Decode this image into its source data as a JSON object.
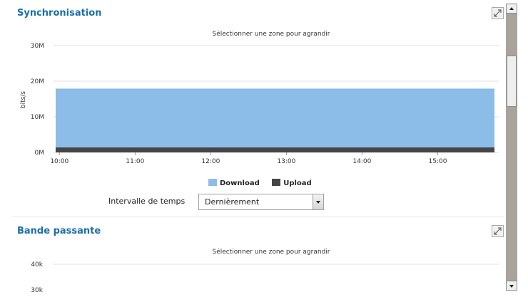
{
  "sections": [
    {
      "title": "Synchronisation",
      "caption": "Sélectionner une zone pour agrandir",
      "legend": [
        {
          "label": "Download",
          "color": "#8cbde8"
        },
        {
          "label": "Upload",
          "color": "#454545"
        }
      ],
      "interval": {
        "label": "Intervalle de temps",
        "value": "Dernièrement"
      }
    },
    {
      "title": "Bande passante",
      "caption": "Sélectionner une zone pour agrandir"
    }
  ],
  "chart_data": [
    {
      "type": "area",
      "title": "",
      "xlabel": "",
      "ylabel": "bits/s",
      "x_ticks": [
        "10:00",
        "11:00",
        "12:00",
        "13:00",
        "14:00",
        "15:00"
      ],
      "y_ticks": [
        "0M",
        "10M",
        "20M",
        "30M"
      ],
      "ylim": [
        0,
        30
      ],
      "xlim": [
        "09:57",
        "15:45"
      ],
      "x": [
        "09:57",
        "15:45"
      ],
      "series": [
        {
          "name": "Download",
          "color": "#8cbde8",
          "values": [
            17.8,
            17.8
          ]
        },
        {
          "name": "Upload",
          "color": "#454545",
          "values": [
            1.4,
            1.4
          ]
        }
      ],
      "grid": true,
      "legend": "bottom"
    },
    {
      "type": "area",
      "title": "",
      "y_ticks": [
        "40k"
      ],
      "grid": true
    }
  ]
}
